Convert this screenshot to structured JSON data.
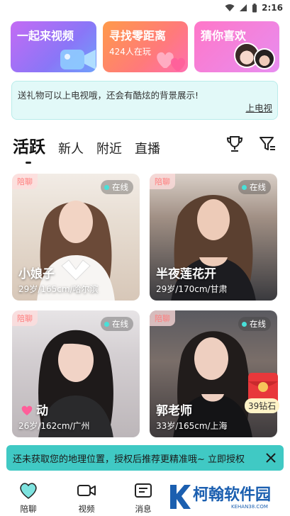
{
  "status_bar": {
    "time": "2:16"
  },
  "banners": [
    {
      "title": "一起来视频",
      "subtitle": ""
    },
    {
      "title": "寻找零距离",
      "subtitle": "424人在玩"
    },
    {
      "title": "猜你喜欢",
      "subtitle": ""
    }
  ],
  "notice": {
    "text": "送礼物可以上电视哦，还会有酷炫的背景展示!",
    "link": "上电视"
  },
  "tabs": [
    "活跃",
    "新人",
    "附近",
    "直播"
  ],
  "cards": [
    {
      "badge": "陪聊",
      "status": "在线",
      "name": "小娘子",
      "info": "29岁/165cm/哈尔滨"
    },
    {
      "badge": "陪聊",
      "status": "在线",
      "name": "半夜莲花开",
      "info": "29岁/170cm/甘肃"
    },
    {
      "badge": "陪聊",
      "status": "在线",
      "name": "动",
      "info": "26岁/162cm/广州"
    },
    {
      "badge": "陪聊",
      "status": "在线",
      "name": "郭老师",
      "info": "33岁/165cm/上海"
    }
  ],
  "red_envelope": {
    "label": "39钻石"
  },
  "location_prompt": {
    "text": "还未获取您的地理位置，授权后推荐更精准哦~ 立即授权"
  },
  "bottom_nav": [
    {
      "label": "陪聊",
      "icon": "heart-chat-icon"
    },
    {
      "label": "视频",
      "icon": "video-camera-icon"
    },
    {
      "label": "消息",
      "icon": "message-icon"
    }
  ],
  "watermark": {
    "title": "柯翰软件园",
    "subtitle": "KEHAN38.COM"
  },
  "colors": {
    "accent": "#40c9c4",
    "online_dot": "#48e0d8",
    "badge_text": "#ff7d7d",
    "envelope_red": "#e8383b"
  }
}
